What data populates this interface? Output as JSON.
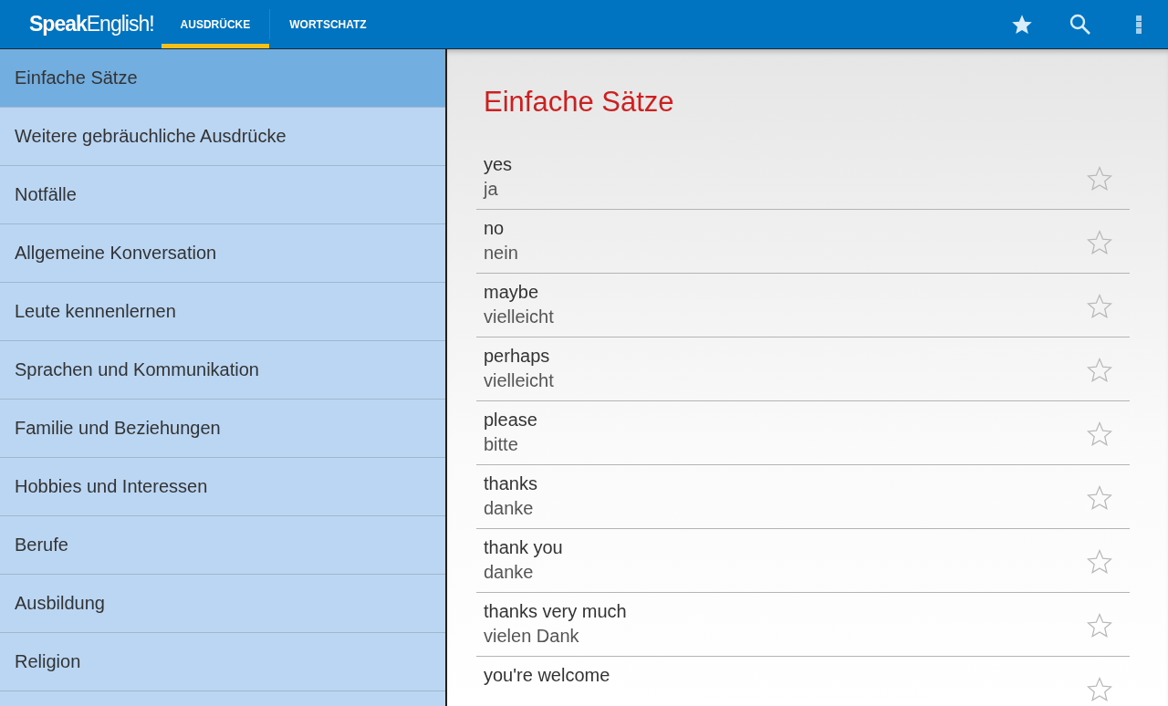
{
  "app_bar": {
    "logo": "**Speak**English!",
    "tabs": [
      {
        "label": "AUSDRÜCKE",
        "selected": true
      },
      {
        "label": "WORTSCHATZ",
        "selected": false
      }
    ]
  },
  "sidebar": {
    "items": [
      {
        "label": "Einfache Sätze",
        "selected": true
      },
      {
        "label": "Weitere gebräuchliche Ausdrücke",
        "selected": false
      },
      {
        "label": "Notfälle",
        "selected": false
      },
      {
        "label": "Allgemeine Konversation",
        "selected": false
      },
      {
        "label": "Leute kennenlernen",
        "selected": false
      },
      {
        "label": "Sprachen und Kommunikation",
        "selected": false
      },
      {
        "label": "Familie und Beziehungen",
        "selected": false
      },
      {
        "label": "Hobbies und Interessen",
        "selected": false
      },
      {
        "label": "Berufe",
        "selected": false
      },
      {
        "label": "Ausbildung",
        "selected": false
      },
      {
        "label": "Religion",
        "selected": false
      }
    ]
  },
  "content": {
    "title": "Einfache Sätze",
    "phrases": [
      {
        "english": "yes",
        "german": "ja",
        "starred": false
      },
      {
        "english": "no",
        "german": "nein",
        "starred": false
      },
      {
        "english": "maybe",
        "german": "vielleicht",
        "starred": false
      },
      {
        "english": "perhaps",
        "german": "vielleicht",
        "starred": false
      },
      {
        "english": "please",
        "german": "bitte",
        "starred": false
      },
      {
        "english": "thanks",
        "german": "danke",
        "starred": false
      },
      {
        "english": "thank you",
        "german": "danke",
        "starred": false
      },
      {
        "english": "thanks very much",
        "german": "vielen Dank",
        "starred": false
      },
      {
        "english": "you're welcome",
        "starred": false
      }
    ]
  }
}
